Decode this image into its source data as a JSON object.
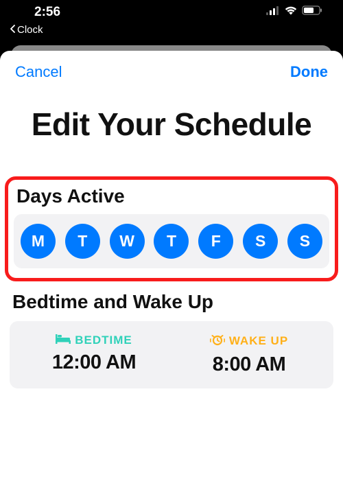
{
  "status": {
    "time": "2:56",
    "back_app": "Clock"
  },
  "nav": {
    "cancel": "Cancel",
    "done": "Done"
  },
  "title": "Edit Your Schedule",
  "days_active": {
    "label": "Days Active",
    "items": [
      "M",
      "T",
      "W",
      "T",
      "F",
      "S",
      "S"
    ]
  },
  "sleep": {
    "section_label": "Bedtime and Wake Up",
    "bedtime": {
      "label": "BEDTIME",
      "time": "12:00 AM"
    },
    "wakeup": {
      "label": "WAKE UP",
      "time": "8:00 AM"
    }
  }
}
